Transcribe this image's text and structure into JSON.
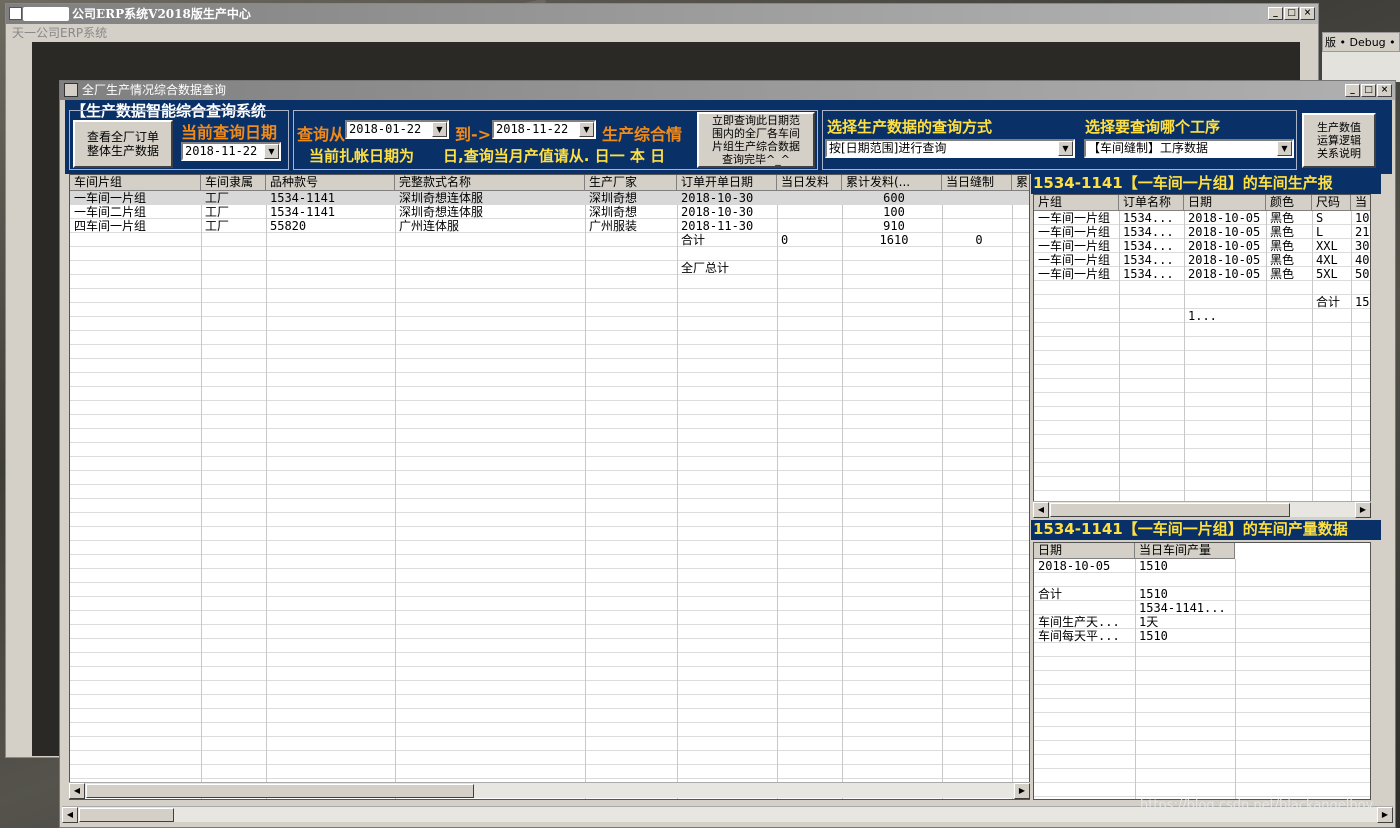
{
  "outer_window": {
    "title": "公司ERP系统V2018版生产中心",
    "menu": "天一公司ERP系统",
    "side_label": "版 • Debug •"
  },
  "main_window": {
    "title": "全厂生产情况综合数据查询"
  },
  "toolbar": {
    "system_title": "【生产数据智能综合查询系统",
    "view_all_button": [
      "查看全厂订单",
      "整体生产数据"
    ],
    "current_query_date_label": "当前查询日期",
    "current_query_date": "2018-11-22",
    "query_from_label": "查询从",
    "from_date": "2018-01-22",
    "to_label": "到->",
    "to_date": "2018-11-22",
    "summary_label": "生产综合情",
    "account_date_text": "当前扎帐日期为",
    "month_value_text": "日,查询当月产值请从.  日一  本  日",
    "query_now_button": [
      "立即查询此日期范",
      "围内的全厂各车间",
      "片组生产综合数据",
      "查询完毕^_^"
    ],
    "query_mode_label": "选择生产数据的查询方式",
    "query_mode_value": "按[日期范围]进行查询",
    "process_label": "选择要查询哪个工序",
    "process_value": "【车间缝制】工序数据",
    "logic_button": [
      "生产数值",
      "运算逻辑",
      "关系说明"
    ]
  },
  "left_grid": {
    "columns": [
      "车间片组",
      "车间隶属",
      "品种款号",
      "完整款式名称",
      "生产厂家",
      "订单开单日期",
      "当日发料",
      "累计发料(...",
      "当日缝制",
      "累"
    ],
    "rows": [
      [
        "一车间一片组",
        "工厂",
        "1534-1141",
        "深圳奇想连体服",
        "深圳奇想",
        "2018-10-30",
        "",
        "600",
        "",
        ""
      ],
      [
        "一车间二片组",
        "工厂",
        "1534-1141",
        "深圳奇想连体服",
        "深圳奇想",
        "2018-10-30",
        "",
        "100",
        "",
        ""
      ],
      [
        "四车间一片组",
        "工厂",
        "55820",
        "广州连体服",
        "广州服装",
        "2018-11-30",
        "",
        "910",
        "",
        ""
      ],
      [
        "",
        "",
        "",
        "",
        "",
        "合计",
        "0",
        "1610",
        "0",
        ""
      ],
      [
        "",
        "",
        "",
        "",
        "",
        "",
        "",
        "",
        "",
        ""
      ],
      [
        "",
        "",
        "",
        "",
        "",
        "全厂总计",
        "",
        "",
        "",
        ""
      ]
    ]
  },
  "right_top": {
    "title": "1534-1141【一车间一片组】的车间生产报",
    "columns": [
      "片组",
      "订单名称",
      "日期",
      "颜色",
      "尺码",
      "当"
    ],
    "rows": [
      [
        "一车间一片组",
        "1534...",
        "2018-10-05",
        "黑色",
        "S",
        "10"
      ],
      [
        "一车间一片组",
        "1534...",
        "2018-10-05",
        "黑色",
        "L",
        "21"
      ],
      [
        "一车间一片组",
        "1534...",
        "2018-10-05",
        "黑色",
        "XXL",
        "30"
      ],
      [
        "一车间一片组",
        "1534...",
        "2018-10-05",
        "黑色",
        "4XL",
        "40"
      ],
      [
        "一车间一片组",
        "1534...",
        "2018-10-05",
        "黑色",
        "5XL",
        "50"
      ],
      [
        "",
        "",
        "",
        "",
        "",
        ""
      ],
      [
        "",
        "",
        "",
        "",
        "合计",
        "15"
      ],
      [
        "",
        "",
        "1...",
        "",
        "",
        ""
      ]
    ]
  },
  "right_bottom": {
    "title": "1534-1141【一车间一片组】的车间产量数据",
    "columns": [
      "日期",
      "当日车间产量"
    ],
    "rows": [
      [
        "2018-10-05",
        "1510"
      ],
      [
        "",
        ""
      ],
      [
        "合计",
        "1510"
      ],
      [
        "",
        "1534-1141..."
      ],
      [
        "车间生产天...",
        "1天"
      ],
      [
        "车间每天平...",
        "1510"
      ]
    ]
  },
  "watermark": "https://blog.csdn.net/blackangelboy"
}
